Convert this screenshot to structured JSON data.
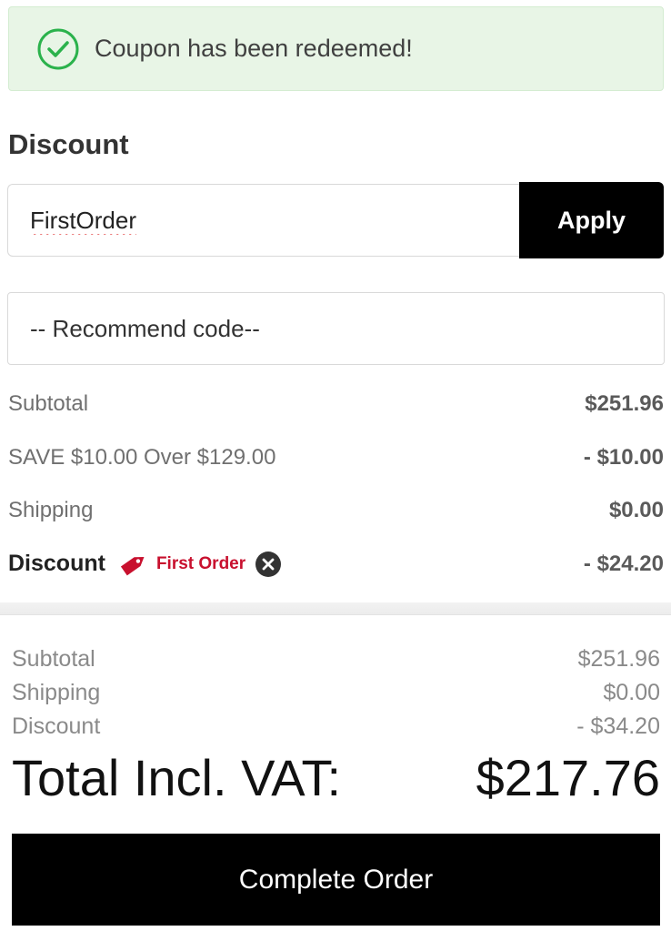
{
  "alert": {
    "message": "Coupon has been redeemed!",
    "icon": "check-circle-icon",
    "color": "#2bb24c"
  },
  "discount_section": {
    "title": "Discount",
    "input_value": "FirstOrder",
    "apply_label": "Apply",
    "recommend_placeholder": "-- Recommend code--"
  },
  "summary": {
    "subtotal_label": "Subtotal",
    "subtotal_value": "$251.96",
    "save_label": "SAVE $10.00 Over $129.00",
    "save_value": "- $10.00",
    "shipping_label": "Shipping",
    "shipping_value": "$0.00",
    "discount_label": "Discount",
    "discount_code": "First Order",
    "discount_value": "- $24.20",
    "tag_icon": "tag-icon",
    "tag_color": "#c8102e",
    "remove_icon": "close-circle-icon"
  },
  "totals": {
    "subtotal_label": "Subtotal",
    "subtotal_value": "$251.96",
    "shipping_label": "Shipping",
    "shipping_value": "$0.00",
    "discount_label": "Discount",
    "discount_value": "- $34.20",
    "total_label": "Total Incl. VAT:",
    "total_value": "$217.76"
  },
  "complete_button_label": "Complete Order"
}
